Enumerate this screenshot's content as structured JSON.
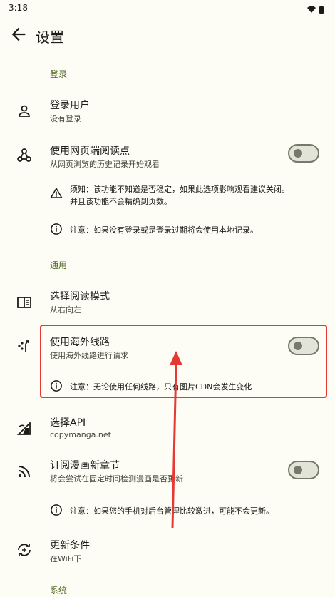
{
  "status_bar": {
    "time": "3:18"
  },
  "app_bar": {
    "title": "设置"
  },
  "sections": {
    "login": "登录",
    "general": "通用",
    "system": "系统"
  },
  "items": {
    "login_user": {
      "title": "登录用户",
      "subtitle": "没有登录"
    },
    "web_reading": {
      "title": "使用网页端阅读点",
      "subtitle": "从网页浏览的历史记录开始观看",
      "enabled": false
    },
    "warning_note": {
      "line1": "须知：该功能不知道是否稳定，如果此选项影响观看建议关闭。",
      "line2": "并且该功能不会精确到页数。"
    },
    "info_note_login": "注意：如果没有登录或是登录过期将会使用本地记录。",
    "reading_mode": {
      "title": "选择阅读模式",
      "subtitle": "从右向左"
    },
    "overseas_route": {
      "title": "使用海外线路",
      "subtitle": "使用海外线路进行请求",
      "enabled": false
    },
    "info_note_route": "注意：无论使用任何线路，只有图片CDN会发生变化",
    "select_api": {
      "title": "选择API",
      "subtitle": "copymanga.net"
    },
    "subscribe": {
      "title": "订阅漫画新章节",
      "subtitle": "将会尝试在固定时间检测漫画是否更新",
      "enabled": false
    },
    "info_note_subscribe": "注意：如果您的手机对后台管理比较激进，可能不会更新。",
    "update_condition": {
      "title": "更新条件",
      "subtitle": "在WiFi下"
    }
  },
  "colors": {
    "accent": "#4c6620",
    "highlight": "#e53935",
    "background": "#fdfcf5"
  }
}
